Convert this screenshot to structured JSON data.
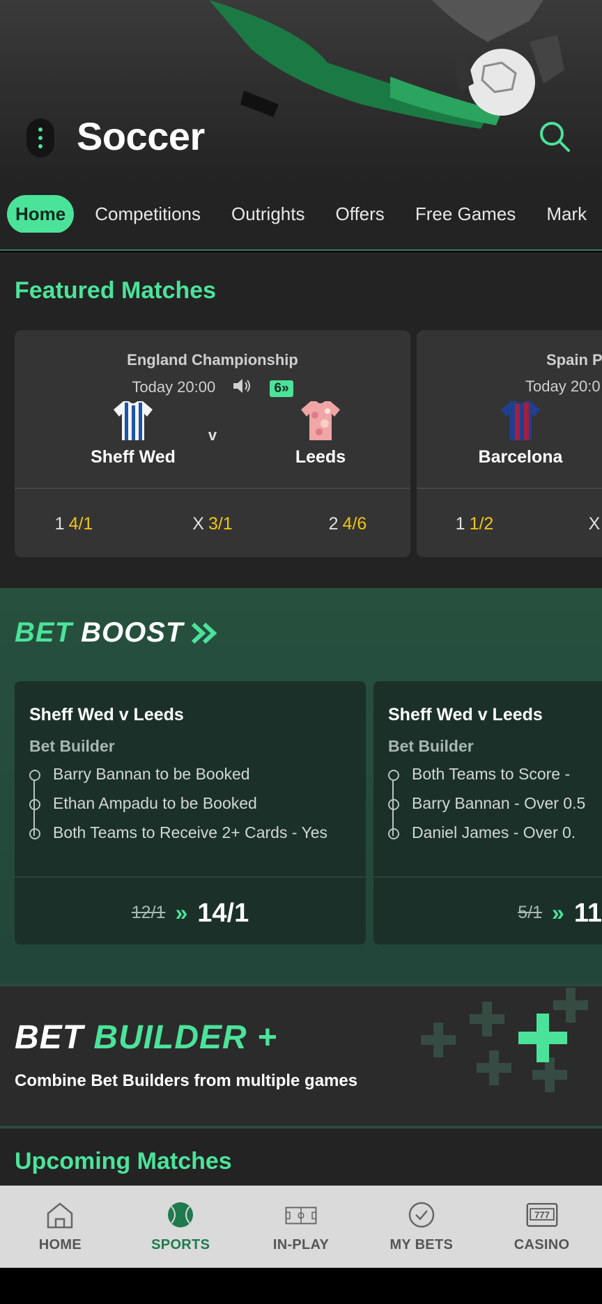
{
  "header": {
    "title": "Soccer"
  },
  "tabs": [
    {
      "label": "Home",
      "active": true
    },
    {
      "label": "Competitions"
    },
    {
      "label": "Outrights"
    },
    {
      "label": "Offers"
    },
    {
      "label": "Free Games"
    },
    {
      "label": "Mark"
    }
  ],
  "featured": {
    "heading": "Featured Matches",
    "matches": [
      {
        "competition": "England Championship",
        "time": "Today 20:00",
        "badge": "6",
        "home": "Sheff Wed",
        "away": "Leeds",
        "vs": "v",
        "odds": [
          {
            "label": "1",
            "price": "4/1"
          },
          {
            "label": "X",
            "price": "3/1"
          },
          {
            "label": "2",
            "price": "4/6"
          }
        ]
      },
      {
        "competition": "Spain P",
        "time": "Today 20:0",
        "home": "Barcelona",
        "odds": [
          {
            "label": "1",
            "price": "1/2"
          },
          {
            "label": "X",
            "price": ""
          }
        ]
      }
    ]
  },
  "boost": {
    "title_a": "BET",
    "title_b": "BOOST",
    "cards": [
      {
        "title": "Sheff Wed v Leeds",
        "type": "Bet Builder",
        "legs": [
          "Barry Bannan to be Booked",
          "Ethan Ampadu to be Booked",
          "Both Teams to Receive 2+ Cards - Yes"
        ],
        "was": "12/1",
        "now": "14/1"
      },
      {
        "title": "Sheff Wed v Leeds",
        "type": "Bet Builder",
        "legs": [
          "Both Teams to Score -",
          "Barry Bannan - Over 0.5",
          "Daniel James - Over 0."
        ],
        "was": "5/1",
        "now": "11"
      }
    ]
  },
  "builder_plus": {
    "title_a": "BET",
    "title_b": "BUILDER +",
    "subtitle": "Combine Bet Builders from multiple games"
  },
  "upcoming": {
    "heading": "Upcoming Matches"
  },
  "bottom_nav": [
    {
      "label": "HOME",
      "icon": "home-icon"
    },
    {
      "label": "SPORTS",
      "icon": "sports-ball-icon",
      "active": true
    },
    {
      "label": "IN-PLAY",
      "icon": "pitch-icon"
    },
    {
      "label": "MY BETS",
      "icon": "check-circle-icon"
    },
    {
      "label": "CASINO",
      "icon": "slot-machine-icon"
    }
  ],
  "colors": {
    "accent": "#4be39a",
    "odds": "#f2c40e",
    "background": "#232323",
    "card": "#343434"
  }
}
